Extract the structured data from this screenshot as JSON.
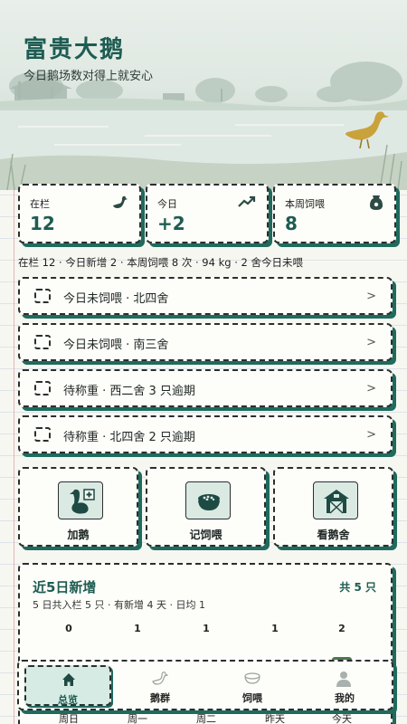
{
  "header": {
    "title": "富贵大鹅",
    "subtitle": "今日鹅场数对得上就安心"
  },
  "stats": [
    {
      "label": "在栏",
      "value": "12",
      "icon": "goose-icon"
    },
    {
      "label": "今日",
      "value": "+2",
      "icon": "trend-up-icon"
    },
    {
      "label": "本周饲喂",
      "value": "8",
      "icon": "feed-bag-icon"
    }
  ],
  "summary": "在栏 12 · 今日新增 2 · 本周饲喂 8 次 · 94 kg · 2 舍今日未喂",
  "todos": [
    {
      "text": "今日未饲喂 · 北四舍",
      "chevron": ">"
    },
    {
      "text": "今日未饲喂 · 南三舍",
      "chevron": ">"
    },
    {
      "text": "待称重 · 西二舍 3 只逾期",
      "chevron": ">"
    },
    {
      "text": "待称重 · 北四舍 2 只逾期",
      "chevron": ">"
    }
  ],
  "actions": [
    {
      "label": "加鹅",
      "icon": "add-goose-icon"
    },
    {
      "label": "记饲喂",
      "icon": "feed-bowl-icon"
    },
    {
      "label": "看鹅舍",
      "icon": "barn-icon"
    }
  ],
  "trend": {
    "title": "近5日新增",
    "total": "共 5 只",
    "subtitle": "5 日共入栏 5 只 · 有新增 4 天 · 日均 1"
  },
  "chart_data": {
    "type": "bar",
    "title": "近5日新增",
    "categories": [
      "周日",
      "周一",
      "周二",
      "昨天",
      "今天"
    ],
    "values": [
      0,
      1,
      1,
      1,
      2
    ],
    "value_labels": [
      "0",
      "1",
      "1",
      "1",
      "2"
    ],
    "ylim": [
      0,
      2
    ],
    "highlight_index": 4,
    "colors": {
      "bar": "#e8eee9",
      "highlight": "#4f7553"
    }
  },
  "nav": {
    "items": [
      {
        "label": "总览",
        "icon": "home-icon",
        "active": true
      },
      {
        "label": "鹅群",
        "icon": "goose-icon",
        "active": false
      },
      {
        "label": "饲喂",
        "icon": "bowl-icon",
        "active": false
      },
      {
        "label": "我的",
        "icon": "user-icon",
        "active": false
      }
    ]
  },
  "colors": {
    "accent": "#1e5c52",
    "shadow": "#1f6b5e",
    "goose": "#c9a23c"
  }
}
